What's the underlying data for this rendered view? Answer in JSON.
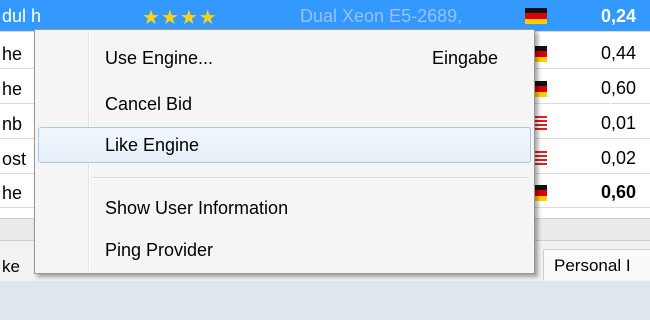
{
  "table": {
    "rows": [
      {
        "left": "dul h",
        "stars": "★★★★",
        "server": "Dual Xeon E5-2689,",
        "flag": "germany",
        "value": "0,24",
        "selected": true
      },
      {
        "left": "he",
        "flag": "germany",
        "value": "0,44"
      },
      {
        "left": "he",
        "flag": "germany",
        "value": "0,60"
      },
      {
        "left": "nb",
        "flag": "usa",
        "value": "0,01"
      },
      {
        "left": "ost",
        "flag": "usa",
        "value": "0,02"
      },
      {
        "left": "he",
        "flag": "germany",
        "value": "0,60",
        "bold": true
      }
    ]
  },
  "tabs": {
    "left_label": "ke",
    "right_label": "Personal I"
  },
  "context_menu": {
    "use_engine": "Use Engine...",
    "use_engine_shortcut": "Eingabe",
    "cancel_bid": "Cancel Bid",
    "like_engine": "Like Engine",
    "show_user_info": "Show User Information",
    "ping_provider": "Ping Provider"
  },
  "colors": {
    "selection": "#3399ff",
    "stars": "#ffd21a",
    "menu_hover_border": "#a8c8e8"
  }
}
